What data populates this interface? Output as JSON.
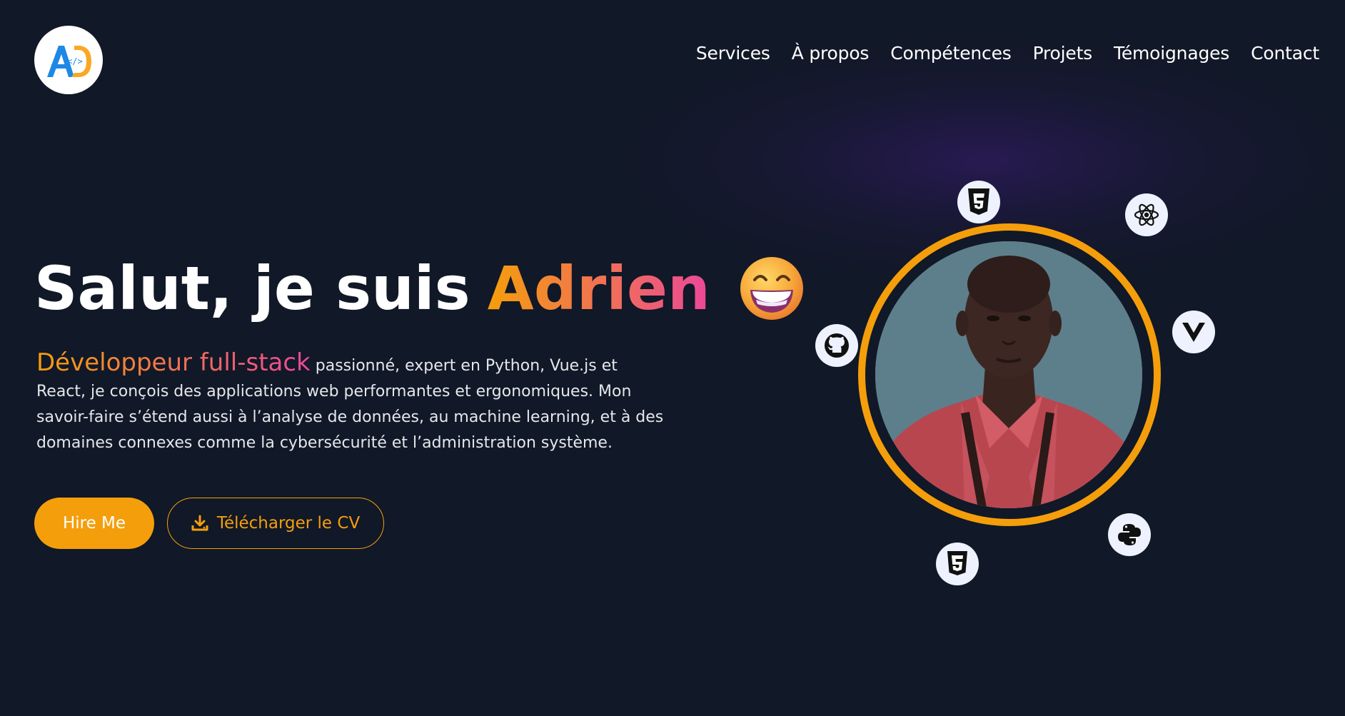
{
  "header": {
    "logo_letters": "AD",
    "logo_code": "</>",
    "nav": [
      {
        "label": "Services"
      },
      {
        "label": "À propos"
      },
      {
        "label": "Compétences"
      },
      {
        "label": "Projets"
      },
      {
        "label": "Témoignages"
      },
      {
        "label": "Contact"
      }
    ]
  },
  "hero": {
    "greeting": "Salut, je suis",
    "name": "Adrien",
    "emoji": "😁",
    "role": "Développeur full-stack",
    "description": " passionné, expert en Python, Vue.js et React, je conçois des applications web performantes et ergonomiques. Mon savoir-faire s’étend aussi à l’analyse de données, au machine learning, et à des domaines connexes comme la cybersécurité et l’administration système."
  },
  "buttons": {
    "hire": "Hire Me",
    "cv": "Télécharger le CV"
  },
  "tech_icons": [
    "css3-icon",
    "react-icon",
    "vue-icon",
    "python-icon",
    "html5-icon",
    "github-icon"
  ],
  "colors": {
    "background": "#111827",
    "accent": "#f59e0b",
    "gradient_end": "#ec4899",
    "icon_bg": "#eef2ff",
    "logo_blue": "#1e88e5",
    "logo_orange": "#f9a825"
  }
}
